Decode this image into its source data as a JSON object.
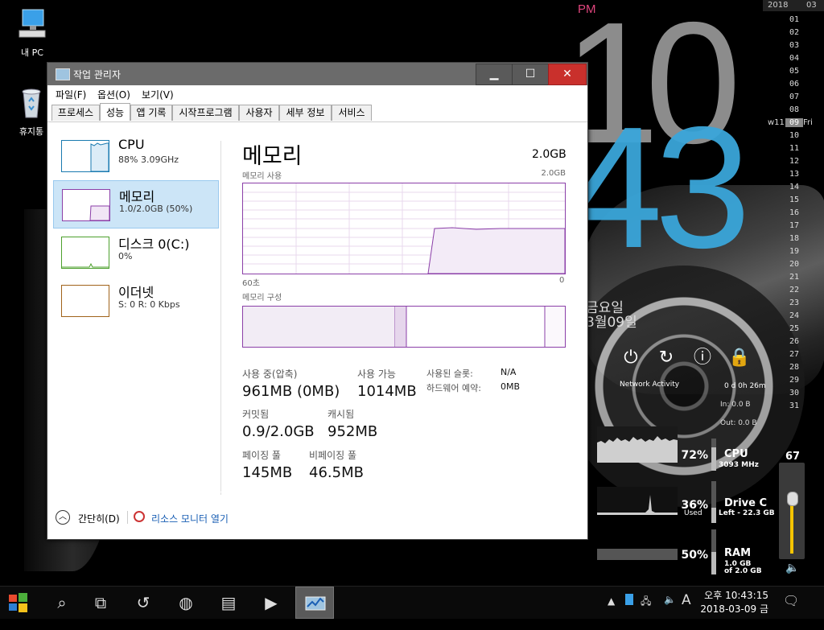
{
  "desktop": {
    "icons": [
      {
        "label": "내 PC"
      },
      {
        "label": "휴지통"
      }
    ]
  },
  "clock": {
    "ampm": "PM",
    "hour": "10",
    "minute": "43",
    "dayname": "금요일",
    "date": "3월09일"
  },
  "calendar": {
    "year": "2018",
    "month": "03",
    "days": [
      "01",
      "02",
      "03",
      "04",
      "05",
      "06",
      "07",
      "08",
      "09",
      "10",
      "11",
      "12",
      "13",
      "14",
      "15",
      "16",
      "17",
      "18",
      "19",
      "20",
      "21",
      "22",
      "23",
      "24",
      "25",
      "26",
      "27",
      "28",
      "29",
      "30",
      "31"
    ],
    "today": "09",
    "week_label": "w11",
    "weekday": "Fri"
  },
  "widgets": {
    "network_activity": "Network Activity",
    "uptime": "0 d 0h 26m",
    "net_in": "In: 0.0 B",
    "net_out": "Out: 0.0 B",
    "cpu": {
      "pct": "72%",
      "name": "CPU",
      "sub": "3093 MHz",
      "level": 0.72
    },
    "drive": {
      "pct": "36%",
      "pct_sub": "Used",
      "name": "Drive C",
      "sub": "Left - 22.3 GB",
      "level": 0.36
    },
    "ram": {
      "pct": "50%",
      "name": "RAM",
      "sub1": "1.0 GB",
      "sub2": "of 2.0 GB",
      "level": 0.5
    },
    "volume": "67"
  },
  "taskmgr": {
    "title": "작업 관리자",
    "menus": [
      "파일(F)",
      "옵션(O)",
      "보기(V)"
    ],
    "tabs": [
      "프로세스",
      "성능",
      "앱 기록",
      "시작프로그램",
      "사용자",
      "세부 정보",
      "서비스"
    ],
    "active_tab": "성능",
    "items": [
      {
        "name": "CPU",
        "value": "88%  3.09GHz",
        "color": "#1a7ab0"
      },
      {
        "name": "메모리",
        "value": "1.0/2.0GB (50%)",
        "color": "#8b3fa8"
      },
      {
        "name": "디스크 0(C:)",
        "value": "0%",
        "color": "#4da02d"
      },
      {
        "name": "이더넷",
        "value": "S: 0  R: 0 Kbps",
        "color": "#a0631a"
      }
    ],
    "memory": {
      "title": "메모리",
      "total": "2.0GB",
      "usage_label": "메모리 사용",
      "usage_max": "2.0GB",
      "axis_left": "60초",
      "axis_right": "0",
      "composition_label": "메모리 구성",
      "in_use_label": "사용 중(압축)",
      "in_use_value": "961MB (0MB)",
      "available_label": "사용 가능",
      "available_value": "1014MB",
      "slots_label": "사용된 슬롯:",
      "slots_value": "N/A",
      "hw_reserved_label": "하드웨어 예약:",
      "hw_reserved_value": "0MB",
      "committed_label": "커밋됨",
      "committed_value": "0.9/2.0GB",
      "cached_label": "캐시됨",
      "cached_value": "952MB",
      "paged_label": "페이징 풀",
      "paged_value": "145MB",
      "nonpaged_label": "비페이징 풀",
      "nonpaged_value": "46.5MB"
    },
    "footer": {
      "simple": "간단히(D)",
      "resmon": "리소스 모니터 열기"
    }
  },
  "taskbar": {
    "ampm": "오후",
    "time": "10:43:15",
    "date": "2018-03-09 금",
    "ime": "A"
  }
}
